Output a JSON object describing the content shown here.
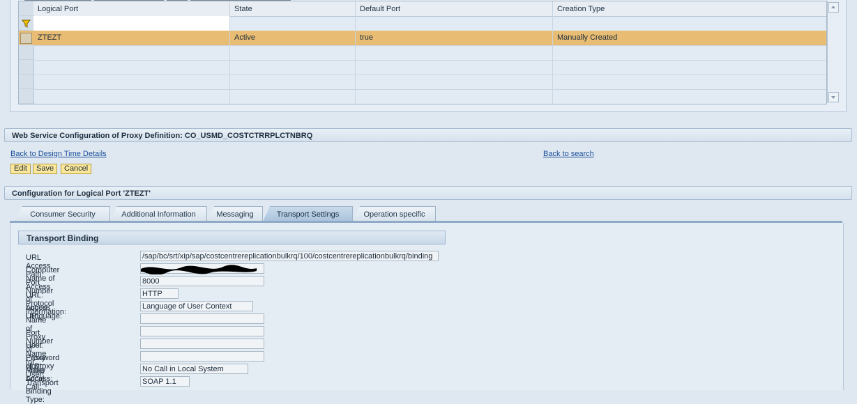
{
  "ports_table": {
    "columns": [
      "Logical Port",
      "State",
      "Default Port",
      "Creation Type"
    ],
    "rows": [
      {
        "logical_port": "ZTEZT",
        "state": "Active",
        "default_port": "true",
        "creation_type": "Manually Created"
      }
    ]
  },
  "config_section": {
    "title": "Web Service Configuration of Proxy Definition: CO_USMD_COSTCTRRPLCTNBRQ",
    "back_design_link": "Back to Design Time Details",
    "back_search_link": "Back to search",
    "buttons": {
      "edit": "Edit",
      "save": "Save",
      "cancel": "Cancel"
    }
  },
  "logical_port_section": {
    "title": "Configuration for Logical Port 'ZTEZT'",
    "tabs": [
      "Consumer Security",
      "Additional Information",
      "Messaging",
      "Transport Settings",
      "Operation specific"
    ],
    "active_tab": "Transport Settings"
  },
  "transport_binding": {
    "title": "Transport Binding",
    "fields": [
      {
        "label": "URL Access Path:",
        "value": "/sap/bc/srt/xip/sap/costcentrereplicationbulkrq/100/costcentrereplicationbulkrq/binding"
      },
      {
        "label": "Computer Name of Access URL:",
        "value": ""
      },
      {
        "label": "Port Number of Access URL:",
        "value": "8000"
      },
      {
        "label": "URL Protocol Information:",
        "value": "HTTP"
      },
      {
        "label": "Logon Language:",
        "value": "Language of User Context"
      },
      {
        "label": "Name of Proxy Host:",
        "value": ""
      },
      {
        "label": "Port Number of Proxy Host:",
        "value": ""
      },
      {
        "label": "User Name for Proxy Access:",
        "value": ""
      },
      {
        "label": "Password of Proxy User:",
        "value": ""
      },
      {
        "label": "Make Local Call:",
        "value": "No Call in Local System"
      },
      {
        "label": "Transport Binding Type:",
        "value": "SOAP 1.1"
      }
    ]
  },
  "colors": {
    "selected_row": "#e8bc73",
    "button_bg": "#fbe79a",
    "link": "#1b4f9a"
  }
}
